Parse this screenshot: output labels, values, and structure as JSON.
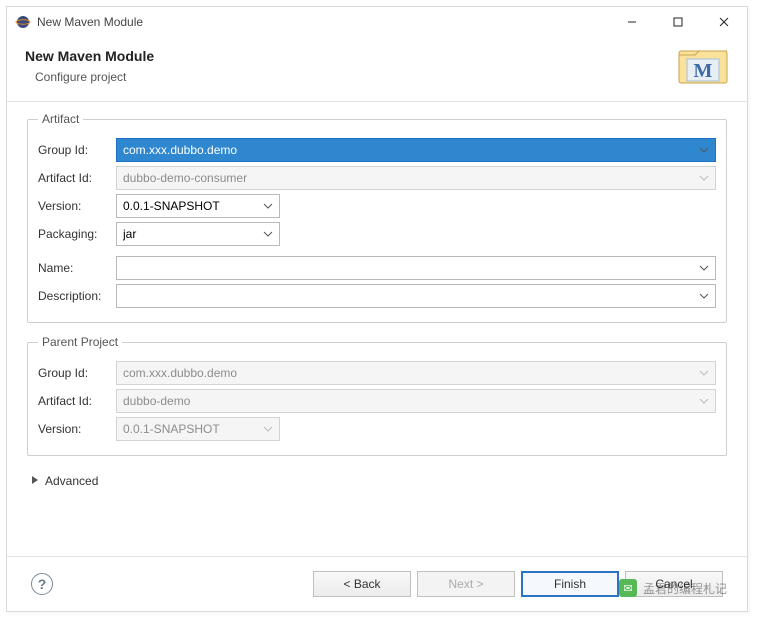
{
  "window": {
    "title": "New Maven Module"
  },
  "header": {
    "title": "New Maven Module",
    "subtitle": "Configure project"
  },
  "artifact": {
    "legend": "Artifact",
    "groupIdLabel": "Group Id:",
    "groupId": "com.xxx.dubbo.demo",
    "artifactIdLabel": "Artifact Id:",
    "artifactId": "dubbo-demo-consumer",
    "versionLabel": "Version:",
    "version": "0.0.1-SNAPSHOT",
    "packagingLabel": "Packaging:",
    "packaging": "jar",
    "nameLabel": "Name:",
    "name": "",
    "descriptionLabel": "Description:",
    "description": ""
  },
  "parent": {
    "legend": "Parent Project",
    "groupIdLabel": "Group Id:",
    "groupId": "com.xxx.dubbo.demo",
    "artifactIdLabel": "Artifact Id:",
    "artifactId": "dubbo-demo",
    "versionLabel": "Version:",
    "version": "0.0.1-SNAPSHOT"
  },
  "advanced": {
    "label": "Advanced"
  },
  "buttons": {
    "back": "< Back",
    "next": "Next >",
    "finish": "Finish",
    "cancel": "Cancel"
  },
  "watermark": "孟君的编程札记"
}
